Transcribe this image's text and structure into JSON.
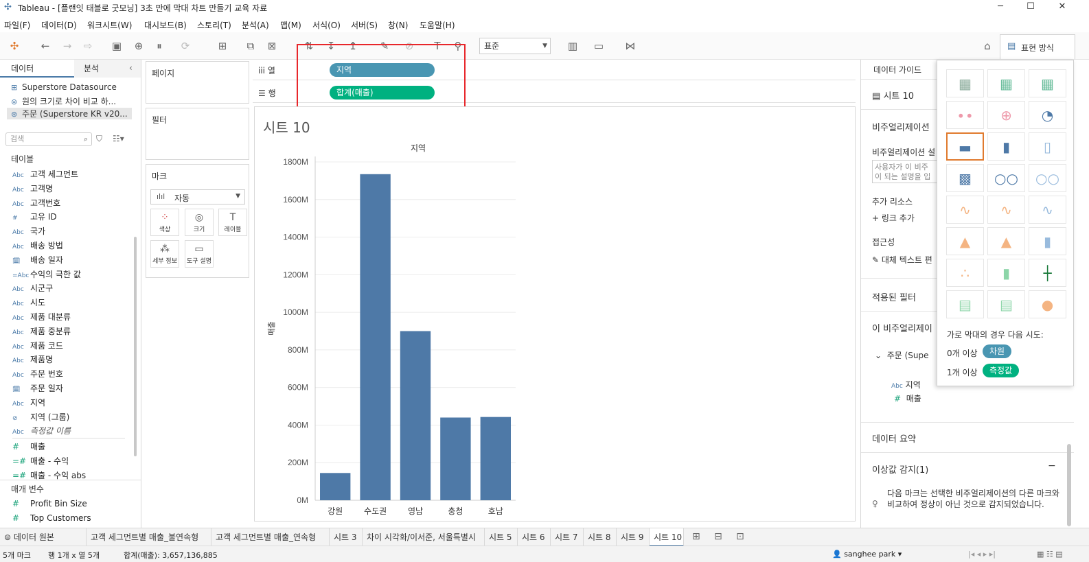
{
  "window": {
    "title": "Tableau - [플랜잇 태블로 굿모닝] 3초 만에 막대 차트 만들기 교육 자료"
  },
  "menu": [
    "파일(F)",
    "데이터(D)",
    "워크시트(W)",
    "대시보드(B)",
    "스토리(T)",
    "분석(A)",
    "맵(M)",
    "서식(O)",
    "서버(S)",
    "창(N)",
    "도움말(H)"
  ],
  "toolbar": {
    "fit_select": "표준",
    "showme_label": "표현 방식"
  },
  "left": {
    "tab_data": "데이터",
    "tab_analysis": "분석",
    "datasources": [
      "Superstore Datasource",
      "원의 크기로 차이 비교 하...",
      "주문 (Superstore KR v20..."
    ],
    "search_placeholder": "검색",
    "tables_header": "테이블",
    "fields": [
      {
        "type": "Abc",
        "name": "고객 세그먼트"
      },
      {
        "type": "Abc",
        "name": "고객명"
      },
      {
        "type": "Abc",
        "name": "고객번호"
      },
      {
        "type": "#",
        "name": "고유 ID"
      },
      {
        "type": "Abc",
        "name": "국가"
      },
      {
        "type": "Abc",
        "name": "배송 방법"
      },
      {
        "type": "date",
        "name": "배송 일자"
      },
      {
        "type": "=Abc",
        "name": "수익의 극한 값"
      },
      {
        "type": "Abc",
        "name": "시군구"
      },
      {
        "type": "Abc",
        "name": "시도"
      },
      {
        "type": "Abc",
        "name": "제품 대분류"
      },
      {
        "type": "Abc",
        "name": "제품 중분류"
      },
      {
        "type": "Abc",
        "name": "제품 코드"
      },
      {
        "type": "Abc",
        "name": "제품명"
      },
      {
        "type": "Abc",
        "name": "주문 번호"
      },
      {
        "type": "date",
        "name": "주문 일자"
      },
      {
        "type": "Abc",
        "name": "지역"
      },
      {
        "type": "group",
        "name": "지역 (그룹)"
      },
      {
        "type": "Abc",
        "name": "측정값 이름"
      }
    ],
    "measures": [
      {
        "type": "#",
        "name": "매출"
      },
      {
        "type": "=#",
        "name": "매출 - 수익"
      },
      {
        "type": "=#",
        "name": "매출 - 수익 abs"
      }
    ],
    "params_header": "매개 변수",
    "params": [
      {
        "type": "#",
        "name": "Profit Bin Size"
      },
      {
        "type": "#",
        "name": "Top Customers"
      }
    ]
  },
  "shelves": {
    "pages": "페이지",
    "filters": "필터",
    "marks": "마크",
    "marks_type": "자동",
    "mark_buttons": [
      "색상",
      "크기",
      "레이블",
      "세부 정보",
      "도구 설명"
    ],
    "columns_label": "열",
    "rows_label": "행",
    "columns_pill": "지역",
    "rows_pill": "합계(매출)"
  },
  "sheet": {
    "title": "시트 10"
  },
  "chart_data": {
    "type": "bar",
    "title": "지역",
    "categories": [
      "강원",
      "수도권",
      "영남",
      "충청",
      "호남"
    ],
    "values": [
      145,
      1735,
      900,
      440,
      443
    ],
    "ylabel": "매출",
    "ylim": [
      0,
      1800
    ],
    "yticks": [
      "0M",
      "200M",
      "400M",
      "600M",
      "800M",
      "1000M",
      "1200M",
      "1400M",
      "1600M",
      "1800M"
    ],
    "bar_color": "#4e79a7",
    "grid": true
  },
  "right": {
    "header": "데이터 가이드",
    "sheet_name": "시트 10",
    "viz_section": "비주얼리제이션",
    "viz_desc_label": "비주얼리제이션 설",
    "desc_placeholder": "사용자가 이 비주\n이 되는 설명을 입",
    "add_resources": "추가 리소스",
    "add_link": "링크 추가",
    "accessibility": "접근성",
    "alt_text": "대체 텍스트 편",
    "applied_filters": "적용된 필터",
    "this_viz": "이 비주얼리제이",
    "ds_name": "주문 (Supe",
    "field_region": "지역",
    "field_sales": "매출",
    "data_summary": "데이터 요약",
    "outliers": "이상값 감지(1)",
    "outlier_text": "다음 마크는 선택한 비주얼리제이션의 다른 마크와 비교하여 정상이 아닌 것으로 감지되었습니다."
  },
  "showme": {
    "hint_title": "가로 막대의 경우 다음 시도:",
    "hint_row1": "0개 이상",
    "hint_row1_pill": "차원",
    "hint_row2": "1개 이상",
    "hint_row2_pill": "측정값"
  },
  "tabs": [
    "데이터 원본",
    "고객 세그먼트별 매출_불연속형",
    "고객 세그먼트별 매출_연속형",
    "시트 3",
    "차이 시각화/이서준, 서울특별시",
    "시트 5",
    "시트 6",
    "시트 7",
    "시트 8",
    "시트 9",
    "시트 10"
  ],
  "status": {
    "marks": "5개 마크",
    "rowcol": "행 1개 x 열 5개",
    "sum": "합계(매출): 3,657,136,885",
    "user": "sanghee park"
  },
  "colors": {
    "dimension": "#4996b2",
    "measure": "#00b180",
    "bar": "#4e79a7",
    "highlight": "#e8272b"
  }
}
